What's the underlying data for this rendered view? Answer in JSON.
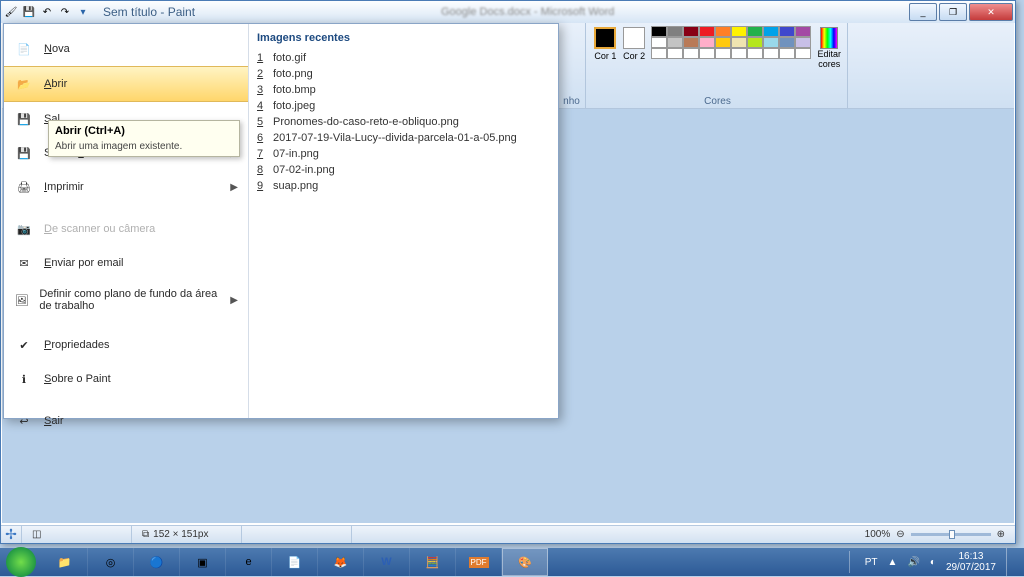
{
  "window": {
    "title": "Sem título - Paint",
    "bg_blur_title": "Google Docs.docx - Microsoft Word"
  },
  "wincontrols": {
    "min": "_",
    "max": "❐",
    "close": "✕"
  },
  "ribbon": {
    "group_size_label": "nho",
    "cor1_label": "Cor 1",
    "cor2_label": "Cor 2",
    "editar_label_line1": "Editar",
    "editar_label_line2": "cores",
    "group_colors": "Cores"
  },
  "colors": {
    "row1": [
      "#000000",
      "#7f7f7f",
      "#880015",
      "#ed1c24",
      "#ff7f27",
      "#fff200",
      "#22b14c",
      "#00a2e8",
      "#3f48cc",
      "#a349a4"
    ],
    "row2": [
      "#ffffff",
      "#c3c3c3",
      "#b97a57",
      "#ffaec9",
      "#ffc90e",
      "#efe4b0",
      "#b5e61d",
      "#99d9ea",
      "#7092be",
      "#c8bfe7"
    ],
    "row3": [
      "#ffffff",
      "#ffffff",
      "#ffffff",
      "#ffffff",
      "#ffffff",
      "#ffffff",
      "#ffffff",
      "#ffffff",
      "#ffffff",
      "#ffffff"
    ]
  },
  "filemenu": {
    "items": [
      {
        "label": "Nova",
        "key": "N",
        "icon": "📄"
      },
      {
        "label": "Abrir",
        "key": "A",
        "icon": "📂",
        "selected": true
      },
      {
        "label": "Salvar",
        "key": "",
        "icon": "💾",
        "short": "Sal"
      },
      {
        "label": "Salvar como",
        "key": "c",
        "icon": "💾",
        "arrow": true
      },
      {
        "label": "Imprimir",
        "key": "I",
        "icon": "🖨",
        "arrow": true
      },
      {
        "label": "De scanner ou câmera",
        "key": "D",
        "icon": "📷",
        "disabled": true
      },
      {
        "label": "Enviar por email",
        "key": "E",
        "icon": "✉"
      },
      {
        "label": "Definir como plano de fundo da área de trabalho",
        "key": "",
        "icon": "🖼",
        "arrow": true
      },
      {
        "label": "Propriedades",
        "key": "P",
        "icon": "✔"
      },
      {
        "label": "Sobre o Paint",
        "key": "S",
        "icon": "ℹ"
      },
      {
        "label": "Sair",
        "key": "S",
        "icon": "↩"
      }
    ],
    "tooltip_title": "Abrir (Ctrl+A)",
    "tooltip_body": "Abrir uma imagem existente.",
    "recent_header": "Imagens recentes",
    "recent": [
      {
        "n": "1",
        "f": "foto.gif"
      },
      {
        "n": "2",
        "f": "foto.png"
      },
      {
        "n": "3",
        "f": "foto.bmp"
      },
      {
        "n": "4",
        "f": "foto.jpeg"
      },
      {
        "n": "5",
        "f": "Pronomes-do-caso-reto-e-obliquo.png"
      },
      {
        "n": "6",
        "f": "2017-07-19-Vila-Lucy--divida-parcela-01-a-05.png"
      },
      {
        "n": "7",
        "f": "07-in.png"
      },
      {
        "n": "8",
        "f": "07-02-in.png"
      },
      {
        "n": "9",
        "f": "suap.png"
      }
    ]
  },
  "statusbar": {
    "dimensions": "152 × 151px",
    "zoom": "100%"
  },
  "tray": {
    "lang": "PT",
    "time": "16:13",
    "date": "29/07/2017"
  }
}
